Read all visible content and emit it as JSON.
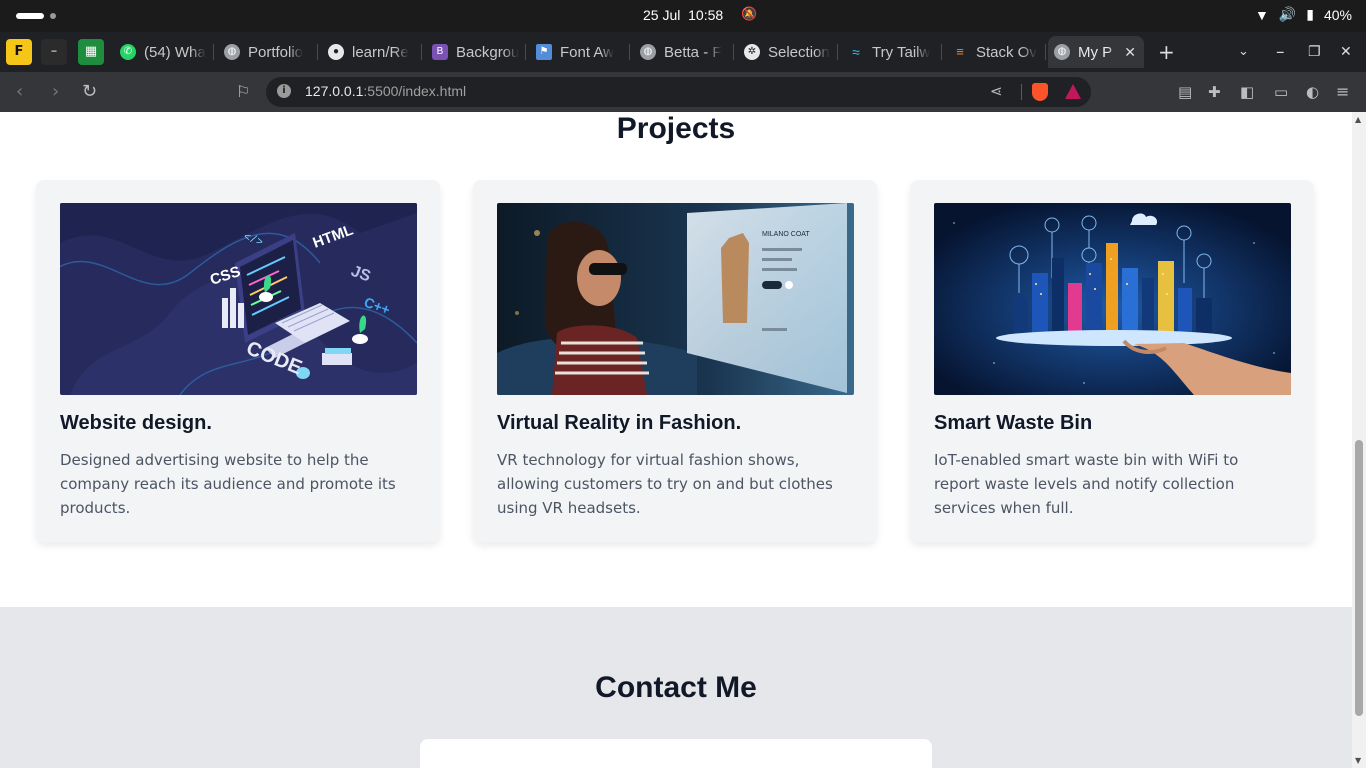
{
  "system_bar": {
    "date": "25 Jul",
    "time": "10:58",
    "battery": "40%"
  },
  "tabs": [
    {
      "title": "(54) Wha",
      "icon": "whatsapp-icon",
      "color": "#25d366"
    },
    {
      "title": "Portfolio",
      "icon": "globe-icon",
      "color": "#9aa0a6"
    },
    {
      "title": "learn/Re",
      "icon": "github-icon",
      "color": "#e8e8e8"
    },
    {
      "title": "Backgrou",
      "icon": "bootstrap-icon",
      "color": "#7952b3",
      "glyph": "B"
    },
    {
      "title": "Font Aw",
      "icon": "flag-icon",
      "color": "#538dd7"
    },
    {
      "title": "Betta - F",
      "icon": "globe-icon",
      "color": "#9aa0a6"
    },
    {
      "title": "Selection",
      "icon": "openai-icon",
      "color": "#e8e8e8"
    },
    {
      "title": "Try Tailw",
      "icon": "tailwind-icon",
      "color": "#38bdf8"
    },
    {
      "title": "Stack Ov",
      "icon": "stackoverflow-icon",
      "color": "#f48024"
    },
    {
      "title": "My P",
      "icon": "globe-icon",
      "color": "#9aa0a6",
      "active": true
    }
  ],
  "address_bar": {
    "url_host": "127.0.0.1",
    "url_rest": ":5500/index.html"
  },
  "projects": {
    "title": "Projects",
    "cards": [
      {
        "title": "Website design.",
        "description": "Designed advertising website to help the company reach its audience and promote its products.",
        "image": "coding illustration with CSS, HTML, JS, C++ and CODE lettering"
      },
      {
        "title": "Virtual Reality in Fashion.",
        "description": "VR technology for virtual fashion shows, allowing customers to try on and but clothes using VR headsets.",
        "image": "woman wearing VR headset viewing coat on virtual screen"
      },
      {
        "title": "Smart Waste Bin",
        "description": "IoT-enabled smart waste bin with WiFi to report waste levels and notify collection services when full.",
        "image": "hand holding smart city with connected icons"
      }
    ]
  },
  "contact": {
    "title": "Contact Me"
  },
  "image_text": {
    "css": "CSS",
    "html": "HTML",
    "js": "JS",
    "cpp": "C++",
    "code": "CODE",
    "vr_heading": "MILANO COAT"
  }
}
